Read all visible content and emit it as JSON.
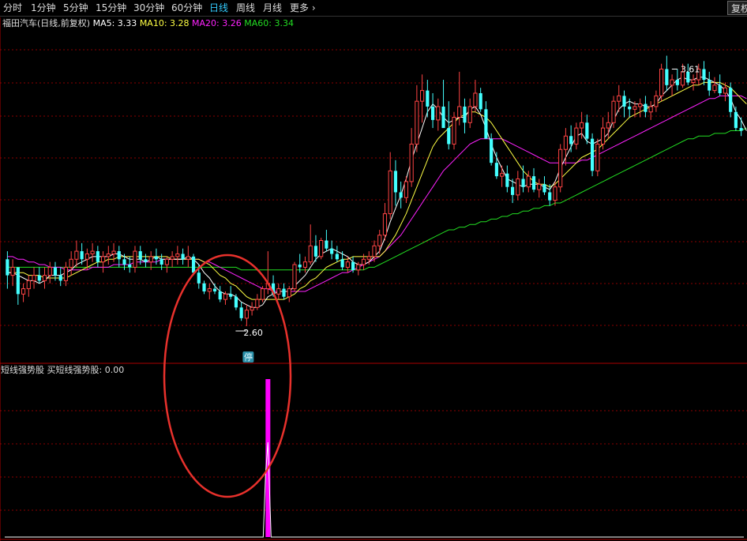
{
  "toolbar": {
    "periods": [
      "分时",
      "1分钟",
      "5分钟",
      "15分钟",
      "30分钟",
      "60分钟",
      "日线",
      "周线",
      "月线"
    ],
    "active": "日线",
    "more_label": "更多",
    "more_icon": "chevron-right-icon",
    "adjust_label": "复权"
  },
  "main_chart": {
    "title": "福田汽车(日线,前复权)",
    "ma": [
      {
        "label": "MA5: 3.33",
        "color": "#ffffff"
      },
      {
        "label": "MA10: 3.28",
        "color": "#ffff44"
      },
      {
        "label": "MA20: 3.26",
        "color": "#ff22ff"
      },
      {
        "label": "MA60: 3.34",
        "color": "#22dd22"
      }
    ],
    "high_label": "3.61",
    "low_label": "2.60",
    "limit_badge": "停",
    "colors": {
      "up": "#ff4444",
      "down": "#44ffff",
      "grid": "#8b0000"
    }
  },
  "indicator": {
    "title": "短线强势股",
    "value_label": "买短线强势股: 0.00",
    "color": "#ff00ff"
  },
  "chart_data": {
    "type": "candlestick",
    "x_count": 140,
    "ylim": [
      2.55,
      3.7
    ],
    "ohlc": [
      [
        2.85,
        2.88,
        2.74,
        2.79
      ],
      [
        2.79,
        2.85,
        2.75,
        2.82
      ],
      [
        2.82,
        2.82,
        2.68,
        2.72
      ],
      [
        2.72,
        2.76,
        2.69,
        2.74
      ],
      [
        2.74,
        2.79,
        2.71,
        2.77
      ],
      [
        2.77,
        2.82,
        2.74,
        2.79
      ],
      [
        2.79,
        2.82,
        2.76,
        2.77
      ],
      [
        2.77,
        2.82,
        2.74,
        2.79
      ],
      [
        2.79,
        2.84,
        2.76,
        2.82
      ],
      [
        2.82,
        2.84,
        2.77,
        2.79
      ],
      [
        2.79,
        2.82,
        2.75,
        2.77
      ],
      [
        2.77,
        2.84,
        2.75,
        2.82
      ],
      [
        2.82,
        2.88,
        2.79,
        2.85
      ],
      [
        2.85,
        2.92,
        2.82,
        2.88
      ],
      [
        2.88,
        2.91,
        2.83,
        2.85
      ],
      [
        2.85,
        2.89,
        2.81,
        2.87
      ],
      [
        2.87,
        2.91,
        2.84,
        2.88
      ],
      [
        2.88,
        2.9,
        2.82,
        2.84
      ],
      [
        2.84,
        2.88,
        2.8,
        2.86
      ],
      [
        2.86,
        2.9,
        2.83,
        2.87
      ],
      [
        2.87,
        2.91,
        2.84,
        2.88
      ],
      [
        2.88,
        2.9,
        2.82,
        2.85
      ],
      [
        2.85,
        2.87,
        2.81,
        2.83
      ],
      [
        2.83,
        2.86,
        2.8,
        2.82
      ],
      [
        2.82,
        2.9,
        2.8,
        2.88
      ],
      [
        2.88,
        2.9,
        2.83,
        2.85
      ],
      [
        2.85,
        2.87,
        2.82,
        2.84
      ],
      [
        2.84,
        2.88,
        2.81,
        2.86
      ],
      [
        2.86,
        2.89,
        2.83,
        2.85
      ],
      [
        2.85,
        2.87,
        2.81,
        2.83
      ],
      [
        2.83,
        2.86,
        2.8,
        2.85
      ],
      [
        2.85,
        2.88,
        2.82,
        2.86
      ],
      [
        2.86,
        2.9,
        2.83,
        2.87
      ],
      [
        2.87,
        2.89,
        2.83,
        2.85
      ],
      [
        2.85,
        2.9,
        2.82,
        2.86
      ],
      [
        2.86,
        2.87,
        2.79,
        2.8
      ],
      [
        2.8,
        2.83,
        2.74,
        2.76
      ],
      [
        2.76,
        2.77,
        2.72,
        2.73
      ],
      [
        2.73,
        2.76,
        2.7,
        2.74
      ],
      [
        2.74,
        2.76,
        2.72,
        2.73
      ],
      [
        2.73,
        2.75,
        2.69,
        2.7
      ],
      [
        2.7,
        2.73,
        2.68,
        2.72
      ],
      [
        2.72,
        2.75,
        2.7,
        2.71
      ],
      [
        2.71,
        2.72,
        2.66,
        2.67
      ],
      [
        2.67,
        2.69,
        2.62,
        2.63
      ],
      [
        2.63,
        2.68,
        2.6,
        2.66
      ],
      [
        2.66,
        2.69,
        2.64,
        2.67
      ],
      [
        2.67,
        2.72,
        2.66,
        2.7
      ],
      [
        2.7,
        2.75,
        2.69,
        2.74
      ],
      [
        2.74,
        2.88,
        2.72,
        2.76
      ],
      [
        2.76,
        2.79,
        2.71,
        2.72
      ],
      [
        2.72,
        2.76,
        2.7,
        2.74
      ],
      [
        2.74,
        2.76,
        2.7,
        2.71
      ],
      [
        2.71,
        2.75,
        2.69,
        2.74
      ],
      [
        2.74,
        2.84,
        2.73,
        2.83
      ],
      [
        2.83,
        2.87,
        2.8,
        2.82
      ],
      [
        2.82,
        2.86,
        2.8,
        2.84
      ],
      [
        2.84,
        2.98,
        2.83,
        2.9
      ],
      [
        2.9,
        2.94,
        2.84,
        2.86
      ],
      [
        2.86,
        2.93,
        2.85,
        2.92
      ],
      [
        2.92,
        2.96,
        2.88,
        2.89
      ],
      [
        2.89,
        2.92,
        2.85,
        2.87
      ],
      [
        2.87,
        2.9,
        2.84,
        2.85
      ],
      [
        2.85,
        2.88,
        2.81,
        2.82
      ],
      [
        2.82,
        2.86,
        2.8,
        2.84
      ],
      [
        2.84,
        2.86,
        2.8,
        2.81
      ],
      [
        2.81,
        2.84,
        2.79,
        2.83
      ],
      [
        2.83,
        2.87,
        2.81,
        2.85
      ],
      [
        2.85,
        2.88,
        2.83,
        2.86
      ],
      [
        2.86,
        2.92,
        2.84,
        2.9
      ],
      [
        2.9,
        2.96,
        2.87,
        2.94
      ],
      [
        2.94,
        3.06,
        2.92,
        3.02
      ],
      [
        3.02,
        3.25,
        3.0,
        3.18
      ],
      [
        3.18,
        3.22,
        3.05,
        3.1
      ],
      [
        3.1,
        3.14,
        3.04,
        3.08
      ],
      [
        3.08,
        3.16,
        3.06,
        3.14
      ],
      [
        3.14,
        3.34,
        3.12,
        3.28
      ],
      [
        3.28,
        3.5,
        3.25,
        3.44
      ],
      [
        3.44,
        3.54,
        3.36,
        3.48
      ],
      [
        3.48,
        3.52,
        3.38,
        3.42
      ],
      [
        3.42,
        3.47,
        3.34,
        3.37
      ],
      [
        3.37,
        3.45,
        3.33,
        3.42
      ],
      [
        3.42,
        3.52,
        3.38,
        3.34
      ],
      [
        3.34,
        3.44,
        3.26,
        3.28
      ],
      [
        3.28,
        3.4,
        3.26,
        3.38
      ],
      [
        3.38,
        3.55,
        3.35,
        3.42
      ],
      [
        3.42,
        3.45,
        3.32,
        3.36
      ],
      [
        3.36,
        3.45,
        3.34,
        3.42
      ],
      [
        3.42,
        3.52,
        3.4,
        3.47
      ],
      [
        3.47,
        3.49,
        3.4,
        3.41
      ],
      [
        3.41,
        3.44,
        3.3,
        3.3
      ],
      [
        3.3,
        3.32,
        3.2,
        3.21
      ],
      [
        3.21,
        3.25,
        3.15,
        3.16
      ],
      [
        3.16,
        3.2,
        3.12,
        3.17
      ],
      [
        3.17,
        3.2,
        3.1,
        3.12
      ],
      [
        3.12,
        3.15,
        3.06,
        3.09
      ],
      [
        3.09,
        3.18,
        3.07,
        3.15
      ],
      [
        3.15,
        3.2,
        3.1,
        3.12
      ],
      [
        3.12,
        3.18,
        3.1,
        3.16
      ],
      [
        3.16,
        3.19,
        3.1,
        3.11
      ],
      [
        3.11,
        3.15,
        3.08,
        3.13
      ],
      [
        3.13,
        3.16,
        3.09,
        3.1
      ],
      [
        3.1,
        3.13,
        3.05,
        3.07
      ],
      [
        3.07,
        3.14,
        3.05,
        3.12
      ],
      [
        3.12,
        3.28,
        3.1,
        3.26
      ],
      [
        3.26,
        3.34,
        3.2,
        3.31
      ],
      [
        3.31,
        3.35,
        3.25,
        3.28
      ],
      [
        3.28,
        3.36,
        3.26,
        3.34
      ],
      [
        3.34,
        3.4,
        3.3,
        3.36
      ],
      [
        3.36,
        3.39,
        3.28,
        3.3
      ],
      [
        3.3,
        3.32,
        3.16,
        3.18
      ],
      [
        3.18,
        3.3,
        3.16,
        3.28
      ],
      [
        3.28,
        3.38,
        3.26,
        3.34
      ],
      [
        3.34,
        3.4,
        3.3,
        3.36
      ],
      [
        3.36,
        3.46,
        3.34,
        3.44
      ],
      [
        3.44,
        3.5,
        3.4,
        3.46
      ],
      [
        3.46,
        3.48,
        3.38,
        3.42
      ],
      [
        3.42,
        3.45,
        3.38,
        3.41
      ],
      [
        3.41,
        3.44,
        3.38,
        3.42
      ],
      [
        3.42,
        3.45,
        3.38,
        3.43
      ],
      [
        3.43,
        3.46,
        3.38,
        3.4
      ],
      [
        3.4,
        3.44,
        3.37,
        3.42
      ],
      [
        3.42,
        3.48,
        3.4,
        3.46
      ],
      [
        3.46,
        3.58,
        3.44,
        3.56
      ],
      [
        3.56,
        3.61,
        3.48,
        3.5
      ],
      [
        3.5,
        3.54,
        3.46,
        3.52
      ],
      [
        3.52,
        3.56,
        3.48,
        3.5
      ],
      [
        3.5,
        3.58,
        3.49,
        3.55
      ],
      [
        3.55,
        3.58,
        3.5,
        3.51
      ],
      [
        3.51,
        3.54,
        3.48,
        3.52
      ],
      [
        3.52,
        3.58,
        3.5,
        3.56
      ],
      [
        3.56,
        3.59,
        3.5,
        3.52
      ],
      [
        3.52,
        3.55,
        3.46,
        3.48
      ],
      [
        3.48,
        3.53,
        3.47,
        3.5
      ],
      [
        3.5,
        3.54,
        3.46,
        3.47
      ],
      [
        3.47,
        3.51,
        3.44,
        3.49
      ],
      [
        3.49,
        3.51,
        3.38,
        3.4
      ],
      [
        3.4,
        3.42,
        3.33,
        3.34
      ],
      [
        3.34,
        3.38,
        3.31,
        3.33
      ]
    ],
    "ma5": [
      2.8,
      2.8,
      2.79,
      2.78,
      2.77,
      2.77,
      2.76,
      2.77,
      2.79,
      2.79,
      2.79,
      2.8,
      2.81,
      2.83,
      2.84,
      2.85,
      2.86,
      2.86,
      2.86,
      2.86,
      2.87,
      2.87,
      2.86,
      2.85,
      2.85,
      2.85,
      2.84,
      2.85,
      2.86,
      2.85,
      2.85,
      2.85,
      2.85,
      2.85,
      2.86,
      2.85,
      2.83,
      2.8,
      2.78,
      2.75,
      2.73,
      2.72,
      2.72,
      2.71,
      2.69,
      2.68,
      2.67,
      2.67,
      2.68,
      2.71,
      2.72,
      2.73,
      2.73,
      2.73,
      2.75,
      2.77,
      2.79,
      2.82,
      2.85,
      2.87,
      2.88,
      2.89,
      2.88,
      2.87,
      2.86,
      2.84,
      2.83,
      2.83,
      2.84,
      2.86,
      2.88,
      2.93,
      2.99,
      3.04,
      3.09,
      3.15,
      3.22,
      3.28,
      3.34,
      3.4,
      3.43,
      3.41,
      3.38,
      3.36,
      3.37,
      3.38,
      3.38,
      3.41,
      3.42,
      3.39,
      3.34,
      3.28,
      3.23,
      3.19,
      3.15,
      3.14,
      3.13,
      3.12,
      3.13,
      3.13,
      3.13,
      3.12,
      3.11,
      3.14,
      3.19,
      3.23,
      3.27,
      3.31,
      3.32,
      3.29,
      3.28,
      3.29,
      3.3,
      3.32,
      3.37,
      3.41,
      3.43,
      3.44,
      3.43,
      3.43,
      3.42,
      3.42,
      3.43,
      3.46,
      3.48,
      3.5,
      3.52,
      3.53,
      3.52,
      3.52,
      3.53,
      3.53,
      3.52,
      3.51,
      3.5,
      3.48,
      3.45,
      3.4,
      3.37,
      3.33
    ],
    "ma10": [
      2.8,
      2.8,
      2.8,
      2.8,
      2.79,
      2.79,
      2.79,
      2.78,
      2.78,
      2.78,
      2.78,
      2.78,
      2.79,
      2.8,
      2.81,
      2.82,
      2.83,
      2.84,
      2.84,
      2.85,
      2.85,
      2.86,
      2.86,
      2.86,
      2.86,
      2.86,
      2.86,
      2.86,
      2.86,
      2.86,
      2.86,
      2.85,
      2.85,
      2.85,
      2.85,
      2.85,
      2.85,
      2.84,
      2.83,
      2.81,
      2.79,
      2.78,
      2.76,
      2.75,
      2.73,
      2.71,
      2.7,
      2.7,
      2.7,
      2.7,
      2.7,
      2.7,
      2.7,
      2.71,
      2.72,
      2.74,
      2.75,
      2.77,
      2.78,
      2.8,
      2.82,
      2.83,
      2.84,
      2.85,
      2.85,
      2.86,
      2.86,
      2.86,
      2.86,
      2.86,
      2.86,
      2.88,
      2.91,
      2.94,
      2.98,
      3.02,
      3.07,
      3.12,
      3.17,
      3.22,
      3.27,
      3.3,
      3.32,
      3.34,
      3.36,
      3.38,
      3.39,
      3.4,
      3.4,
      3.39,
      3.38,
      3.36,
      3.33,
      3.3,
      3.27,
      3.24,
      3.21,
      3.18,
      3.16,
      3.14,
      3.13,
      3.13,
      3.12,
      3.13,
      3.15,
      3.17,
      3.19,
      3.21,
      3.23,
      3.24,
      3.25,
      3.26,
      3.28,
      3.3,
      3.32,
      3.34,
      3.36,
      3.38,
      3.39,
      3.4,
      3.41,
      3.42,
      3.43,
      3.44,
      3.45,
      3.46,
      3.47,
      3.48,
      3.49,
      3.5,
      3.5,
      3.51,
      3.51,
      3.51,
      3.51,
      3.5,
      3.49,
      3.47,
      3.45,
      3.43
    ],
    "ma20": [
      2.86,
      2.86,
      2.85,
      2.85,
      2.84,
      2.84,
      2.83,
      2.83,
      2.82,
      2.82,
      2.82,
      2.81,
      2.81,
      2.81,
      2.81,
      2.81,
      2.82,
      2.82,
      2.82,
      2.82,
      2.83,
      2.83,
      2.83,
      2.83,
      2.84,
      2.84,
      2.84,
      2.84,
      2.84,
      2.85,
      2.85,
      2.85,
      2.85,
      2.85,
      2.85,
      2.85,
      2.85,
      2.84,
      2.84,
      2.83,
      2.82,
      2.81,
      2.8,
      2.79,
      2.78,
      2.77,
      2.76,
      2.75,
      2.74,
      2.74,
      2.73,
      2.73,
      2.73,
      2.73,
      2.73,
      2.73,
      2.73,
      2.74,
      2.75,
      2.76,
      2.77,
      2.78,
      2.79,
      2.8,
      2.8,
      2.81,
      2.82,
      2.83,
      2.84,
      2.85,
      2.86,
      2.88,
      2.9,
      2.92,
      2.94,
      2.97,
      3.0,
      3.03,
      3.06,
      3.09,
      3.12,
      3.15,
      3.18,
      3.2,
      3.22,
      3.24,
      3.26,
      3.28,
      3.29,
      3.3,
      3.3,
      3.3,
      3.3,
      3.3,
      3.29,
      3.28,
      3.27,
      3.26,
      3.25,
      3.24,
      3.23,
      3.22,
      3.21,
      3.21,
      3.21,
      3.21,
      3.21,
      3.21,
      3.22,
      3.22,
      3.23,
      3.24,
      3.25,
      3.26,
      3.27,
      3.28,
      3.29,
      3.3,
      3.31,
      3.32,
      3.33,
      3.34,
      3.35,
      3.36,
      3.37,
      3.38,
      3.39,
      3.4,
      3.41,
      3.42,
      3.43,
      3.44,
      3.45,
      3.45,
      3.46,
      3.46,
      3.46,
      3.46,
      3.46,
      3.45
    ],
    "ma60": [
      2.82,
      2.82,
      2.82,
      2.82,
      2.82,
      2.82,
      2.82,
      2.82,
      2.82,
      2.82,
      2.82,
      2.82,
      2.82,
      2.82,
      2.82,
      2.82,
      2.82,
      2.82,
      2.82,
      2.82,
      2.82,
      2.82,
      2.82,
      2.82,
      2.82,
      2.82,
      2.82,
      2.82,
      2.82,
      2.82,
      2.82,
      2.82,
      2.82,
      2.82,
      2.82,
      2.82,
      2.82,
      2.82,
      2.82,
      2.82,
      2.82,
      2.82,
      2.82,
      2.82,
      2.81,
      2.81,
      2.81,
      2.81,
      2.81,
      2.81,
      2.81,
      2.81,
      2.81,
      2.81,
      2.81,
      2.81,
      2.81,
      2.81,
      2.81,
      2.81,
      2.81,
      2.81,
      2.81,
      2.81,
      2.81,
      2.81,
      2.81,
      2.81,
      2.82,
      2.82,
      2.83,
      2.84,
      2.85,
      2.86,
      2.87,
      2.88,
      2.89,
      2.9,
      2.91,
      2.92,
      2.93,
      2.94,
      2.95,
      2.96,
      2.96,
      2.97,
      2.97,
      2.98,
      2.98,
      2.99,
      2.99,
      3.0,
      3.0,
      3.01,
      3.01,
      3.02,
      3.02,
      3.03,
      3.03,
      3.04,
      3.04,
      3.05,
      3.05,
      3.06,
      3.06,
      3.07,
      3.08,
      3.09,
      3.1,
      3.11,
      3.12,
      3.13,
      3.14,
      3.15,
      3.16,
      3.17,
      3.18,
      3.19,
      3.2,
      3.21,
      3.22,
      3.23,
      3.24,
      3.25,
      3.26,
      3.27,
      3.28,
      3.29,
      3.3,
      3.3,
      3.31,
      3.31,
      3.31,
      3.32,
      3.32,
      3.32,
      3.33,
      3.33,
      3.33,
      3.34
    ],
    "indicator_signal_index": 49,
    "indicator_signal_value": 1.0,
    "high_index": 126,
    "low_index": 45
  }
}
